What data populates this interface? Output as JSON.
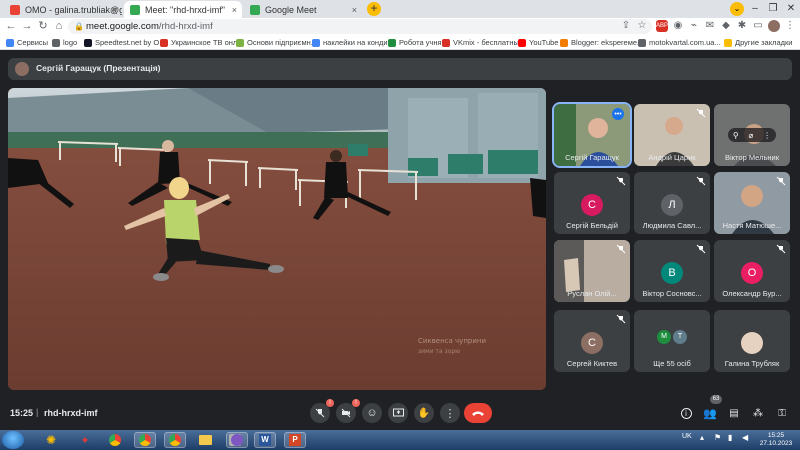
{
  "browser": {
    "tabs": [
      {
        "title": "ОМО - galina.trubliak@gmail.com",
        "favicon_color": "#ea4335",
        "active": false
      },
      {
        "title": "Meet: \"rhd-hrxd-imf\"",
        "favicon_color": "#34a853",
        "active": true
      },
      {
        "title": "Google Meet",
        "favicon_color": "#34a853",
        "active": false
      }
    ],
    "new_tab_label": "+",
    "close_label": "×",
    "address": {
      "host": "meet.google.com",
      "path": "/rhd-hrxd-imf"
    },
    "bookmarks": [
      {
        "label": "Сервисы",
        "color": "#4285f4"
      },
      {
        "label": "logo",
        "color": "#5f6368"
      },
      {
        "label": "Speedtest.net by O...",
        "color": "#141526"
      },
      {
        "label": "Украинское ТВ онл...",
        "color": "#d93025"
      },
      {
        "label": "Основи підприємн...",
        "color": "#7cb342"
      },
      {
        "label": "наклейки на конди...",
        "color": "#4285f4"
      },
      {
        "label": "Робота учня",
        "color": "#1e8e3e"
      },
      {
        "label": "VKmix - бесплатны...",
        "color": "#d93025"
      },
      {
        "label": "YouTube",
        "color": "#ff0000"
      },
      {
        "label": "Blogger: eksperеме...",
        "color": "#f57c00"
      },
      {
        "label": "motokvartal.com.ua...",
        "color": "#5f6368"
      },
      {
        "label": "Другие закладки",
        "color": "#fbbc04"
      }
    ]
  },
  "meet": {
    "presenter_label": "Сергій Гаращук (Презентація)",
    "participants": [
      {
        "name": "Сергій Гаращук",
        "type": "video",
        "active": true,
        "bg": "#9a8c7a"
      },
      {
        "name": "Андрій Царик",
        "type": "video",
        "bg": "#b5a896"
      },
      {
        "name": "Віктор Мельник",
        "type": "video",
        "bg": "#6d6e6a"
      },
      {
        "name": "Сергій Бельдій",
        "type": "avatar",
        "initial": "С",
        "color": "#d81b60"
      },
      {
        "name": "Людмила Савл...",
        "type": "avatar",
        "initial": "Л",
        "color": "#5f6368"
      },
      {
        "name": "Настя Матюше...",
        "type": "video",
        "bg": "#7e8a93"
      },
      {
        "name": "Руслан Олій...",
        "type": "video",
        "bg": "#8d7f6e"
      },
      {
        "name": "Віктор Сосновс...",
        "type": "avatar",
        "initial": "В",
        "color": "#00897b"
      },
      {
        "name": "Олександр Бур...",
        "type": "avatar",
        "initial": "О",
        "color": "#e91e63"
      },
      {
        "name": "Сергей Киктев",
        "type": "avatar",
        "initial": "С",
        "color": "#8d6e63"
      },
      {
        "name": "Ще 55 осіб",
        "type": "more",
        "initials": [
          "М",
          "Т"
        ]
      },
      {
        "name": "Галина Трубляк",
        "type": "avatar",
        "initial": "Г",
        "color": "#b0a090"
      }
    ],
    "watermark_line1": "Сиквенса чуприни",
    "watermark_line2": "зими та зорю",
    "time": "15:25",
    "meeting_code": "rhd-hrxd-imf",
    "participant_count": "63",
    "mic_badge": "!",
    "cam_badge": "!"
  },
  "taskbar": {
    "language": "UK",
    "time": "15:25",
    "date": "27.10.2023"
  }
}
